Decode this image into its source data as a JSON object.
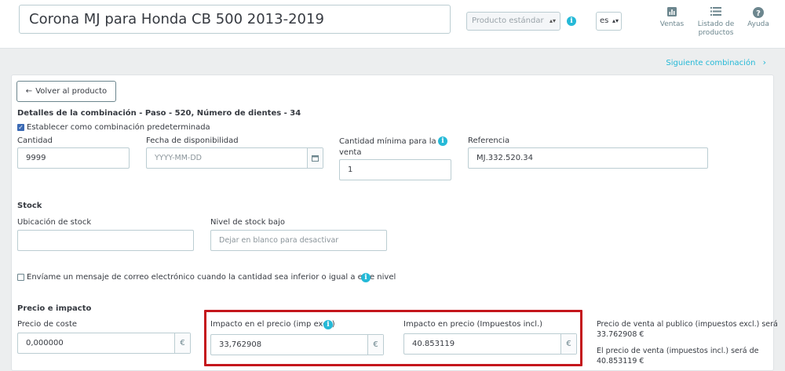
{
  "header": {
    "product_name": "Corona MJ para Honda CB 500 2013-2019",
    "product_type": "Producto estándar",
    "language": "es",
    "buttons": {
      "sales": "Ventas",
      "product_list_line1": "Listado de",
      "product_list_line2": "productos",
      "help": "Ayuda"
    }
  },
  "nav": {
    "next_combination": "Siguiente combinación"
  },
  "combination": {
    "back_button": "Volver al producto",
    "details_title": "Detalles de la combinación - Paso - 520, Número de dientes - 34",
    "default_checkbox_label": "Establecer como combinación predeterminada",
    "default_checked": true,
    "quantity": {
      "label": "Cantidad",
      "value": "9999"
    },
    "availability_date": {
      "label": "Fecha de disponibilidad",
      "placeholder": "YYYY-MM-DD"
    },
    "min_quantity": {
      "label_line1": "Cantidad mínima para la",
      "label_line2": "venta",
      "value": "1"
    },
    "reference": {
      "label": "Referencia",
      "value": "MJ.332.520.34"
    }
  },
  "stock": {
    "title": "Stock",
    "location": {
      "label": "Ubicación de stock",
      "value": ""
    },
    "low_stock": {
      "label": "Nivel de stock bajo",
      "placeholder": "Dejar en blanco para desactivar"
    },
    "email_alert_label": "Envíame un mensaje de correo electrónico cuando la cantidad sea inferior o igual a este nivel",
    "email_alert_checked": false
  },
  "price": {
    "title": "Precio e impacto",
    "cost": {
      "label": "Precio de coste",
      "value": "0,000000",
      "currency": "€"
    },
    "impact_excl": {
      "label": "Impacto en el precio (imp excl.)",
      "value": "33,762908",
      "currency": "€"
    },
    "impact_incl": {
      "label": "Impacto en precio (Impuestos incl.)",
      "value": "40.853119",
      "currency": "€"
    },
    "summary": {
      "retail_excl_line": "Precio de venta al publico (impuestos excl.) será",
      "retail_excl_value": "33.762908 €",
      "retail_incl_line": "El precio de venta (impuestos incl.) será de",
      "retail_incl_value": "40.853119 €"
    }
  },
  "colors": {
    "accent": "#25b9d7",
    "highlight_border": "#c4161c",
    "checkbox": "#3b6ab4"
  }
}
